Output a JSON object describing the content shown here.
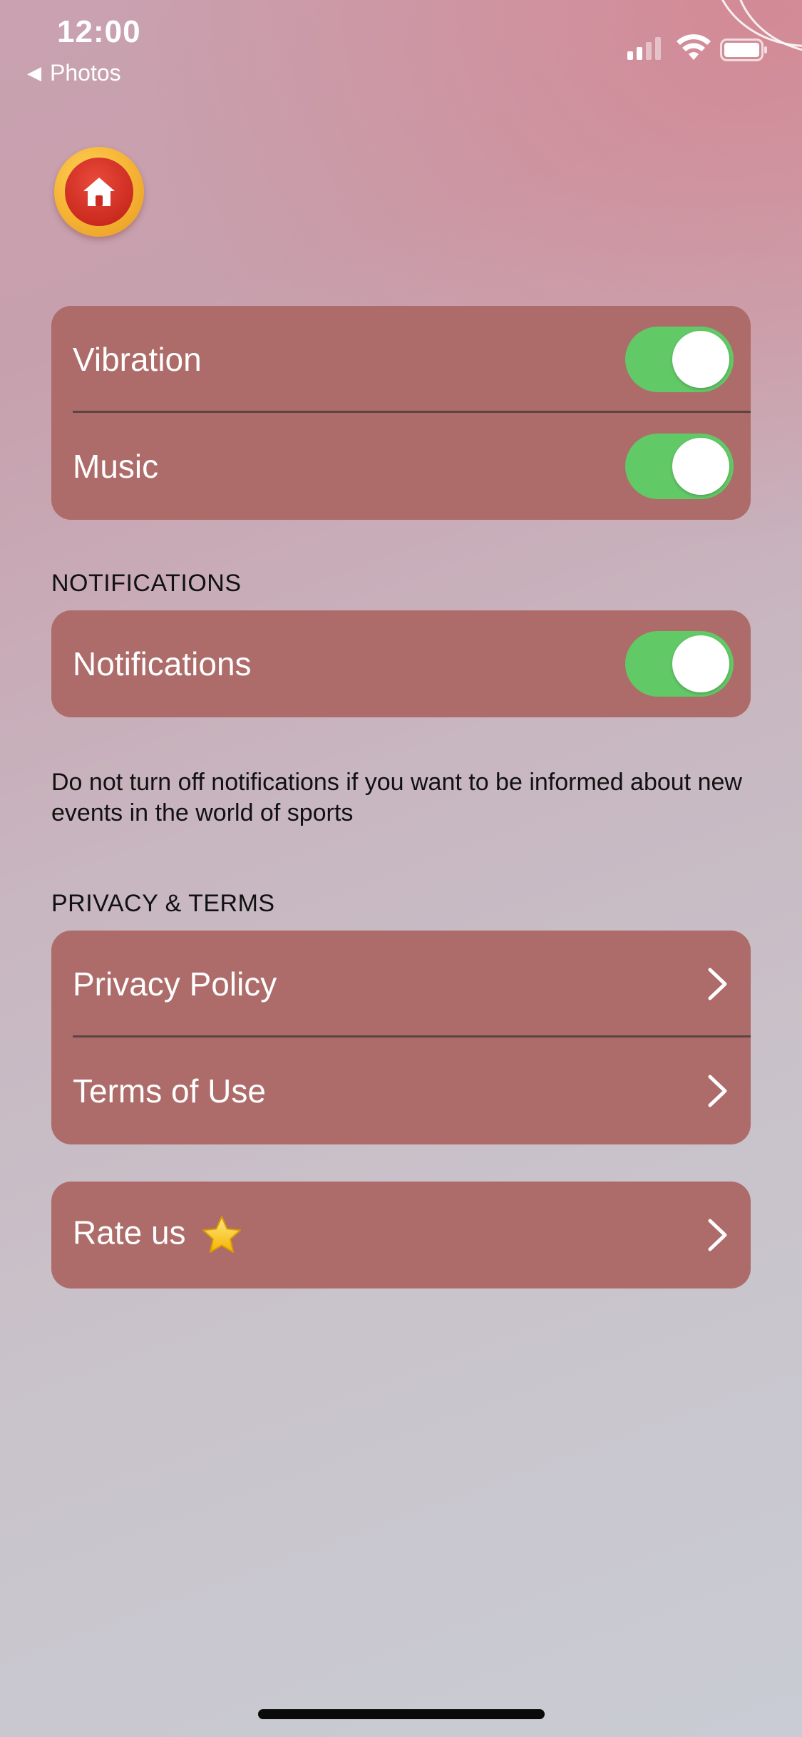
{
  "status_bar": {
    "time": "12:00",
    "back_label": "Photos",
    "signal_icon": "cellular-signal-icon",
    "wifi_icon": "wifi-icon",
    "battery_icon": "battery-icon"
  },
  "home_button": {
    "icon": "home-icon"
  },
  "settings": {
    "vibration": {
      "label": "Vibration",
      "enabled": true
    },
    "music": {
      "label": "Music",
      "enabled": true
    }
  },
  "notifications": {
    "section_header": "NOTIFICATIONS",
    "label": "Notifications",
    "enabled": true,
    "footnote": "Do not turn off notifications if you want to be informed about new events in the world of sports"
  },
  "privacy": {
    "section_header": "PRIVACY & TERMS",
    "privacy_policy_label": "Privacy Policy",
    "terms_label": "Terms of Use"
  },
  "rate": {
    "label": "Rate us",
    "icon": "star-icon"
  },
  "colors": {
    "card": "#ad6c69",
    "toggle_on": "#62c967",
    "home_outer": "#f5b233",
    "home_inner": "#cc2b20"
  }
}
